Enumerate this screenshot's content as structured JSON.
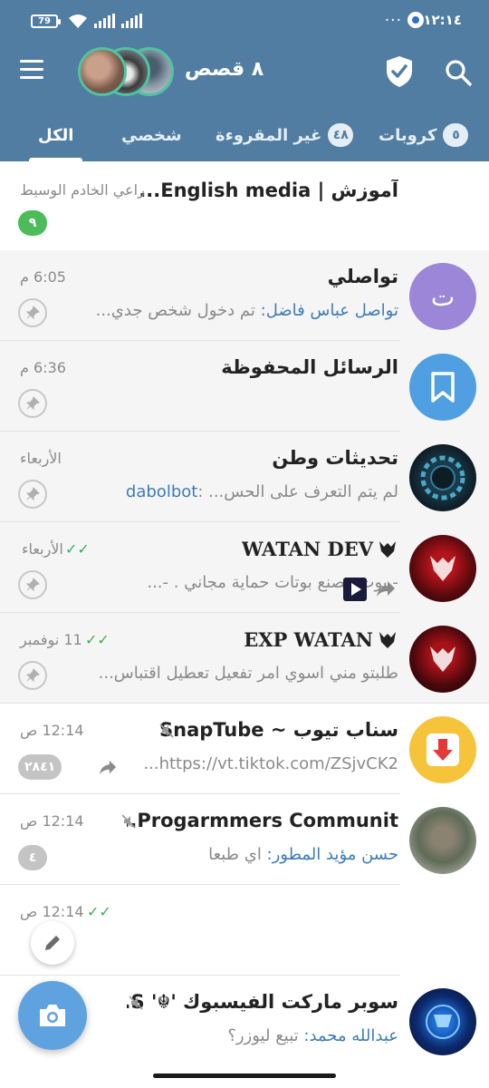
{
  "status_bar": {
    "time": "١٢:١٤",
    "dots": "...",
    "battery": "79"
  },
  "header": {
    "stories_title": "٨ قصص"
  },
  "tabs": [
    {
      "label": "الكل",
      "active": true
    },
    {
      "label": "شخصي",
      "active": false
    },
    {
      "label": "غير المقروءة",
      "badge": "٤٨",
      "active": false
    },
    {
      "label": "كروبات",
      "badge": "٥",
      "active": false
    }
  ],
  "chats": [
    {
      "name": "آموزش | English media...",
      "preview": "",
      "time": "راعي الخادم الوسيط",
      "unread": "٩",
      "unread_color": "#4cbb59"
    },
    {
      "name": "تواصلي",
      "avatar_letter": "ت",
      "avatar_color": "#9b86d8",
      "sender": "تواصل عباس فاضل:",
      "preview": " تم دخول شخص جدي...",
      "time": "6:05 م",
      "pinned": true
    },
    {
      "name": "الرسائل المحفوظة",
      "avatar_color": "#4f9fe2",
      "preview": "",
      "time": "6:36 م",
      "pinned": true
    },
    {
      "name": "تحديثات وطن",
      "preview": "لم يتم التعرف على الحس... :",
      "preview_link": "dabolbot",
      "time": "الأربعاء",
      "pinned": true
    },
    {
      "name": "WATAN DEV",
      "preview": "- بوت مصنع بوتات حماية مجاني . -...",
      "time": "الأربعاء",
      "pinned": true,
      "read": true
    },
    {
      "name": "EXP WATAN",
      "preview": "طلبتو مني اسوي امر تفعيل تعطيل اقتباس...",
      "time": "11 نوفمبر",
      "pinned": true,
      "read": true
    },
    {
      "name": "سناب تيوب ~ SnapTube",
      "avatar_color": "#f6c43a",
      "preview": "https://vt.tiktok.com/ZSjvCK2...",
      "time": "12:14 ص",
      "unread": "٢٨٤١",
      "unread_color": "#c4c4c4",
      "muted": true
    },
    {
      "name": "Progarmmers Communit...",
      "sender": "حسن مؤيد المطور:",
      "preview": " اي طبعا",
      "time": "12:14 ص",
      "unread": "٤",
      "unread_color": "#c4c4c4",
      "muted": true
    },
    {
      "name": "",
      "preview": "",
      "time": "12:14 ص",
      "read": true
    },
    {
      "name": "سوبر ماركت الفيسبوك '☬' S....",
      "sender": "عبدالله محمد:",
      "preview": " تبيع ليوزر؟",
      "time": "",
      "muted": true
    }
  ],
  "colors": {
    "header": "#517da2",
    "accent": "#3d7cb8",
    "unread_green": "#4cbb59",
    "tick_green": "#3bb054"
  }
}
